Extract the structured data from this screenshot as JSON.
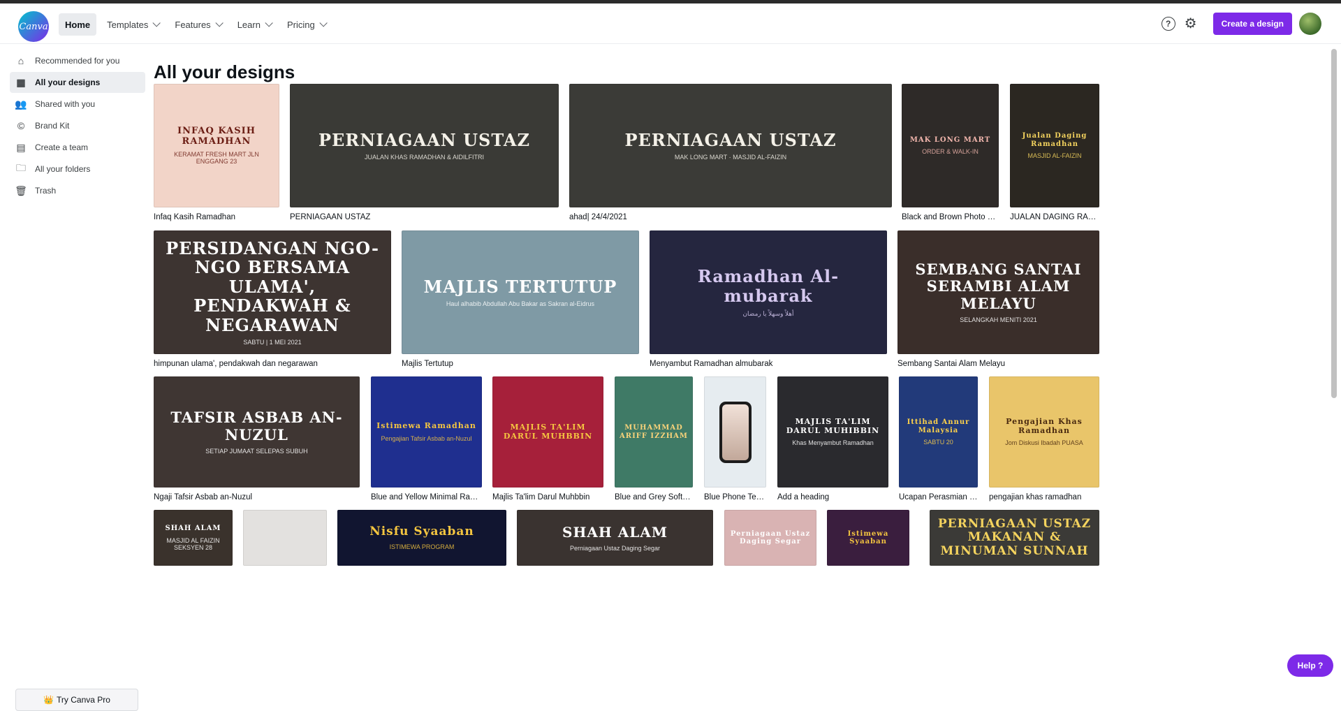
{
  "app": {
    "logo_text": "Canva"
  },
  "nav": [
    {
      "label": "Home",
      "active": true,
      "dropdown": false
    },
    {
      "label": "Templates",
      "dropdown": true
    },
    {
      "label": "Features",
      "dropdown": true
    },
    {
      "label": "Learn",
      "dropdown": true
    },
    {
      "label": "Pricing",
      "dropdown": true
    }
  ],
  "header": {
    "help_icon": "?",
    "create_label": "Create a design"
  },
  "sidebar": {
    "items": [
      {
        "label": "Recommended for you",
        "icon": "home-icon",
        "glyph": "⌂"
      },
      {
        "label": "All your designs",
        "icon": "grid-icon",
        "glyph": "▦",
        "active": true
      },
      {
        "label": "Shared with you",
        "icon": "people-icon",
        "glyph": "👥"
      },
      {
        "label": "Brand Kit",
        "icon": "brand-icon",
        "glyph": "©"
      },
      {
        "label": "Create a team",
        "icon": "building-icon",
        "glyph": "▤"
      },
      {
        "label": "All your folders",
        "icon": "folder-icon",
        "glyph": "🗀"
      },
      {
        "label": "Trash",
        "icon": "trash-icon",
        "glyph": "🗑"
      }
    ],
    "pro_label": "Try Canva Pro",
    "pro_icon": "👑"
  },
  "main": {
    "title": "All your designs"
  },
  "designs": [
    {
      "name": "Infaq Kasih Ramadhan",
      "thumb_title": "INFAQ KASIH RAMADHAN",
      "thumb_sub": "KERAMAT FRESH MART JLN ENGGANG 23",
      "bg": "#f2d4c8",
      "fg": "#6b1d14"
    },
    {
      "name": "PERNIAGAAN USTAZ",
      "thumb_title": "PERNIAGAAN USTAZ",
      "thumb_sub": "JUALAN KHAS RAMADHAN & AIDILFITRI",
      "bg": "#3a3a36",
      "fg": "#f4f1e8"
    },
    {
      "name": "ahad| 24/4/2021",
      "thumb_title": "PERNIAGAAN USTAZ",
      "thumb_sub": "MAK LONG MART · MASJID AL-FAIZIN",
      "bg": "#3b3b37",
      "fg": "#f4f1e8"
    },
    {
      "name": "Black and Brown Photo Bbq ...",
      "thumb_title": "MAK LONG MART",
      "thumb_sub": "ORDER & WALK-IN",
      "bg": "#2e2a28",
      "fg": "#f2b6ad"
    },
    {
      "name": "JUALAN DAGING RAMADH...",
      "thumb_title": "Jualan Daging Ramadhan",
      "thumb_sub": "MASJID AL-FAIZIN",
      "bg": "#2b2721",
      "fg": "#f4d35e"
    },
    {
      "name": "himpunan ulama', pendakwah dan negarawan",
      "thumb_title": "PERSIDANGAN NGO-NGO BERSAMA ULAMA', PENDAKWAH & NEGARAWAN",
      "thumb_sub": "SABTU | 1 MEI 2021",
      "bg": "#3d3431",
      "fg": "#ffffff"
    },
    {
      "name": "Majlis Tertutup",
      "thumb_title": "MAJLIS TERTUTUP",
      "thumb_sub": "Haul alhabib Abdullah Abu Bakar as Sakran al-Eidrus",
      "bg": "#7f9aa5",
      "fg": "#ffffff"
    },
    {
      "name": "Menyambut Ramadhan almubarak",
      "thumb_title": "Ramadhan Al-mubarak",
      "thumb_sub": "أهلاً وسهلاً يا رمضان",
      "bg": "#25263f",
      "fg": "#d6c9f0"
    },
    {
      "name": "Sembang Santai Alam Melayu",
      "thumb_title": "SEMBANG SANTAI SERAMBI ALAM MELAYU",
      "thumb_sub": "SELANGKAH MENITI 2021",
      "bg": "#3a2e2a",
      "fg": "#ffffff"
    },
    {
      "name": "Ngaji Tafsir Asbab an-Nuzul",
      "thumb_title": "TAFSIR ASBAB AN-NUZUL",
      "thumb_sub": "SETIAP JUMAAT SELEPAS SUBUH",
      "bg": "#3f3633",
      "fg": "#ffffff"
    },
    {
      "name": "Blue and Yellow Minimal Ramada...",
      "thumb_title": "Istimewa Ramadhan",
      "thumb_sub": "Pengajian Tafsir Asbab an-Nuzul",
      "bg": "#1f2f8f",
      "fg": "#f5c640"
    },
    {
      "name": "Majlis Ta'lim Darul Muhbbin",
      "thumb_title": "MAJLIS TA'LIM DARUL MUHBBIN",
      "thumb_sub": "",
      "bg": "#a6203a",
      "fg": "#f5c640"
    },
    {
      "name": "Blue and Grey Software...",
      "thumb_title": "MUHAMMAD ARIFF IZZHAM",
      "thumb_sub": "",
      "bg": "#3f7a66",
      "fg": "#f7d27a"
    },
    {
      "name": "Blue Phone Text ...",
      "thumb_title": "",
      "thumb_sub": "",
      "bg": "#e6ecf0",
      "fg": "#1c2329"
    },
    {
      "name": "Add a heading",
      "thumb_title": "MAJLIS TA'LIM DARUL MUHIBBIN",
      "thumb_sub": "Khas Menyambut Ramadhan",
      "bg": "#2a2a2e",
      "fg": "#ffffff"
    },
    {
      "name": "Ucapan Perasmian Pro...",
      "thumb_title": "Ittihad Annur Malaysia",
      "thumb_sub": "SABTU 20",
      "bg": "#223a7a",
      "fg": "#ffd24a"
    },
    {
      "name": "pengajian khas ramadhan",
      "thumb_title": "Pengajian Khas Ramadhan",
      "thumb_sub": "Jom Diskusi Ibadah PUASA",
      "bg": "#e9c56a",
      "fg": "#4a2a10"
    },
    {
      "name": "",
      "thumb_title": "SHAH ALAM",
      "thumb_sub": "MASJID AL FAIZIN SEKSYEN 28",
      "bg": "#3a322c",
      "fg": "#ffffff"
    },
    {
      "name": "",
      "thumb_title": "",
      "thumb_sub": "",
      "bg": "#e3e1df",
      "fg": "#333333"
    },
    {
      "name": "",
      "thumb_title": "Nisfu Syaaban",
      "thumb_sub": "ISTIMEWA PROGRAM",
      "bg": "#111530",
      "fg": "#f5c640"
    },
    {
      "name": "",
      "thumb_title": "SHAH ALAM",
      "thumb_sub": "Perniagaan Ustaz Daging Segar",
      "bg": "#3a3330",
      "fg": "#ffffff"
    },
    {
      "name": "",
      "thumb_title": "Perniagaan Ustaz Daging Segar",
      "thumb_sub": "",
      "bg": "#d9b3b3",
      "fg": "#ffffff"
    },
    {
      "name": "",
      "thumb_title": "Istimewa Syaaban",
      "thumb_sub": "",
      "bg": "#3a1e3e",
      "fg": "#f5c640"
    },
    {
      "name": "",
      "thumb_title": "PERNIAGAAN USTAZ MAKANAN & MINUMAN SUNNAH",
      "thumb_sub": "",
      "bg": "#3b3a37",
      "fg": "#f4d35e"
    }
  ],
  "help": {
    "label": "Help ?"
  }
}
